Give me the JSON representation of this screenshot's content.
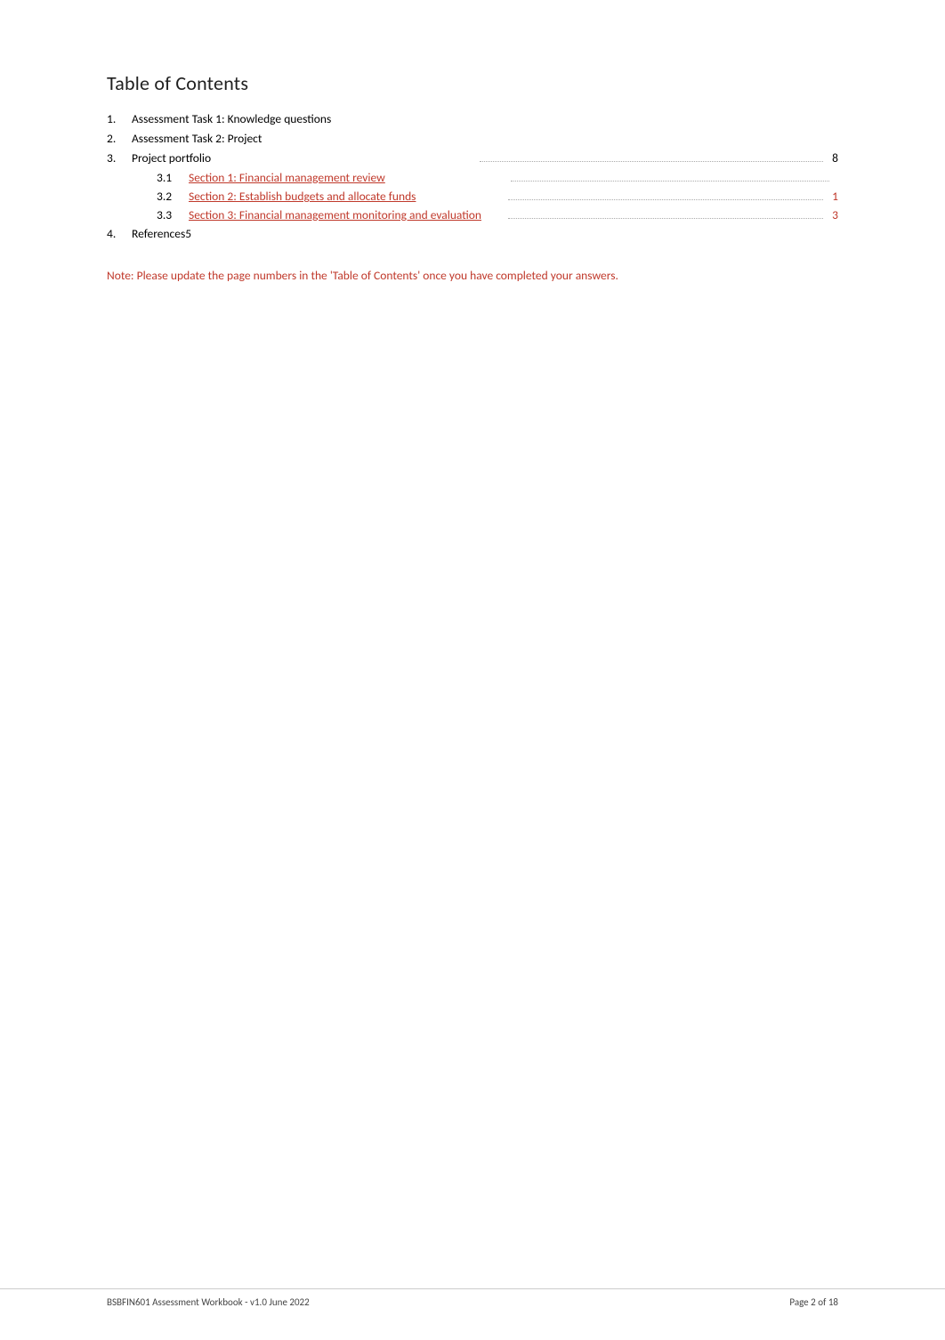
{
  "toc": {
    "heading": "Table of Contents",
    "items": [
      {
        "number": "1.",
        "label": "Assessment Task 1: Knowledge questions",
        "page": "",
        "sub": []
      },
      {
        "number": "2.",
        "label": "Assessment Task 2: Project",
        "page": "",
        "sub": []
      },
      {
        "number": "3.",
        "label": "Project portfolio",
        "page": "8",
        "sub": [
          {
            "number": "3.1",
            "label": "Section 1: Financial management review",
            "page": ""
          },
          {
            "number": "3.2",
            "label": "Section 2: Establish budgets and allocate funds",
            "page": "1"
          },
          {
            "number": "3.3",
            "label": "Section 3: Financial management monitoring and evaluation",
            "page": "3"
          }
        ]
      },
      {
        "number": "4.",
        "label": "References5",
        "page": "",
        "sub": []
      }
    ],
    "note": "Note: Please update the page numbers in the 'Table of Contents' once you have completed your answers."
  },
  "footer": {
    "left": "BSBFIN601 Assessment Workbook - v1.0 June 2022",
    "right": "Page  2  of 18"
  }
}
